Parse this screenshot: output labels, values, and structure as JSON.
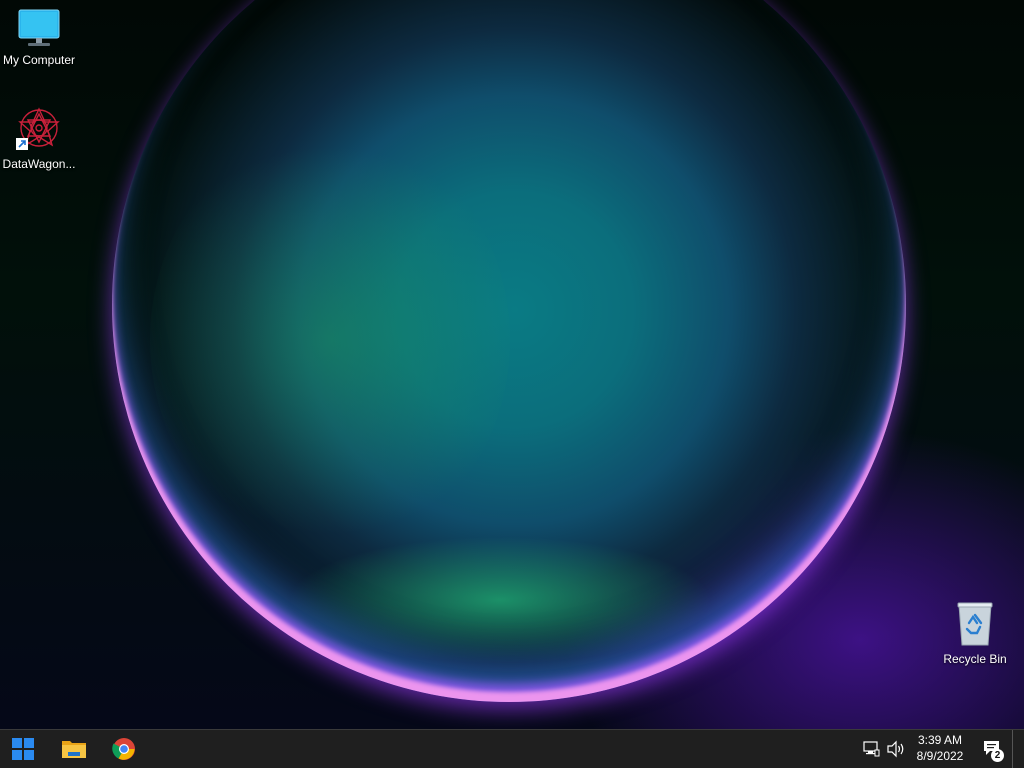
{
  "desktop": {
    "icons": [
      {
        "label": "My Computer",
        "icon": "computer-monitor-icon"
      },
      {
        "label": "DataWagon...",
        "icon": "datawagon-shortcut-icon"
      },
      {
        "label": "Recycle Bin",
        "icon": "recycle-bin-icon"
      }
    ]
  },
  "taskbar": {
    "start_icon": "windows-start-icon",
    "pinned": [
      {
        "icon": "file-explorer-icon"
      },
      {
        "icon": "chrome-icon"
      }
    ],
    "tray": {
      "network_icon": "network-icon",
      "volume_icon": "volume-icon",
      "time": "3:39 AM",
      "date": "8/9/2022",
      "notification_count": "2"
    }
  },
  "colors": {
    "taskbar_bg": "#1f1f1f",
    "start_blue": "#2a8af0",
    "monitor_blue": "#3ab8f0"
  }
}
